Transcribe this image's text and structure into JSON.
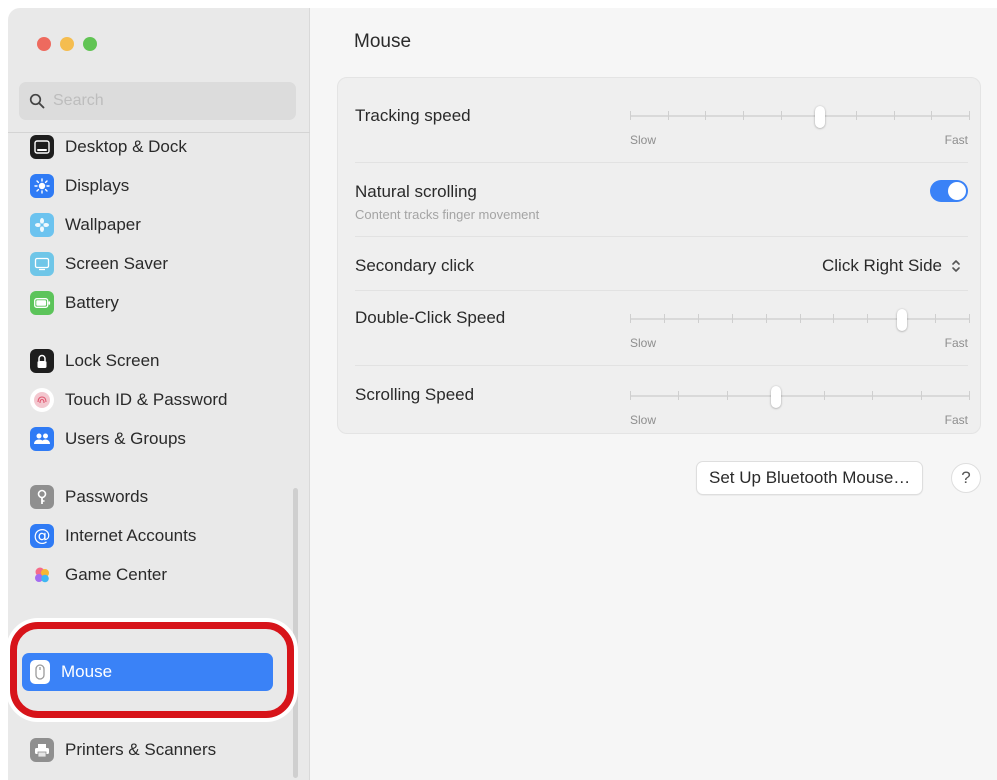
{
  "window": {
    "traffic_lights": [
      "close",
      "minimize",
      "zoom"
    ]
  },
  "sidebar": {
    "search_placeholder": "Search",
    "items": [
      {
        "label": "Desktop & Dock",
        "icon": "dock-icon",
        "color": "#1e1e1e"
      },
      {
        "label": "Displays",
        "icon": "sun-icon",
        "color": "#2f7bf5"
      },
      {
        "label": "Wallpaper",
        "icon": "flower-icon",
        "color": "#6cc3ef"
      },
      {
        "label": "Screen Saver",
        "icon": "screen-saver-icon",
        "color": "#6fc6e8"
      },
      {
        "label": "Battery",
        "icon": "battery-icon",
        "color": "#5cc45a"
      },
      {
        "label": "Lock Screen",
        "icon": "lock-icon",
        "color": "#1e1e1e"
      },
      {
        "label": "Touch ID & Password",
        "icon": "fingerprint-icon",
        "color": "#ffffff"
      },
      {
        "label": "Users & Groups",
        "icon": "users-icon",
        "color": "#2f7bf5"
      },
      {
        "label": "Passwords",
        "icon": "key-icon",
        "color": "#8f8f8f"
      },
      {
        "label": "Internet Accounts",
        "icon": "at-icon",
        "color": "#2f7bf5"
      },
      {
        "label": "Game Center",
        "icon": "game-center-icon",
        "color": "#ffffff"
      },
      {
        "label": "Mouse",
        "icon": "mouse-icon",
        "color": "#ffffff"
      },
      {
        "label": "Printers & Scanners",
        "icon": "printer-icon",
        "color": "#8f8f8f"
      }
    ],
    "selected_index": 11
  },
  "main": {
    "title": "Mouse",
    "rows": {
      "tracking_speed": {
        "label": "Tracking speed",
        "min": "Slow",
        "max": "Fast",
        "value": 0.56
      },
      "natural_scrolling": {
        "label": "Natural scrolling",
        "sub": "Content tracks finger movement",
        "on": true
      },
      "secondary_click": {
        "label": "Secondary click",
        "value": "Click Right Side"
      },
      "double_click_speed": {
        "label": "Double-Click Speed",
        "min": "Slow",
        "max": "Fast",
        "value": 0.8
      },
      "scrolling_speed": {
        "label": "Scrolling Speed",
        "min": "Slow",
        "max": "Fast",
        "value": 0.43
      }
    },
    "bluetooth_button": "Set Up Bluetooth Mouse…",
    "help_label": "?"
  },
  "colors": {
    "accent": "#3a82f7",
    "highlight_ring": "#d7141a"
  }
}
